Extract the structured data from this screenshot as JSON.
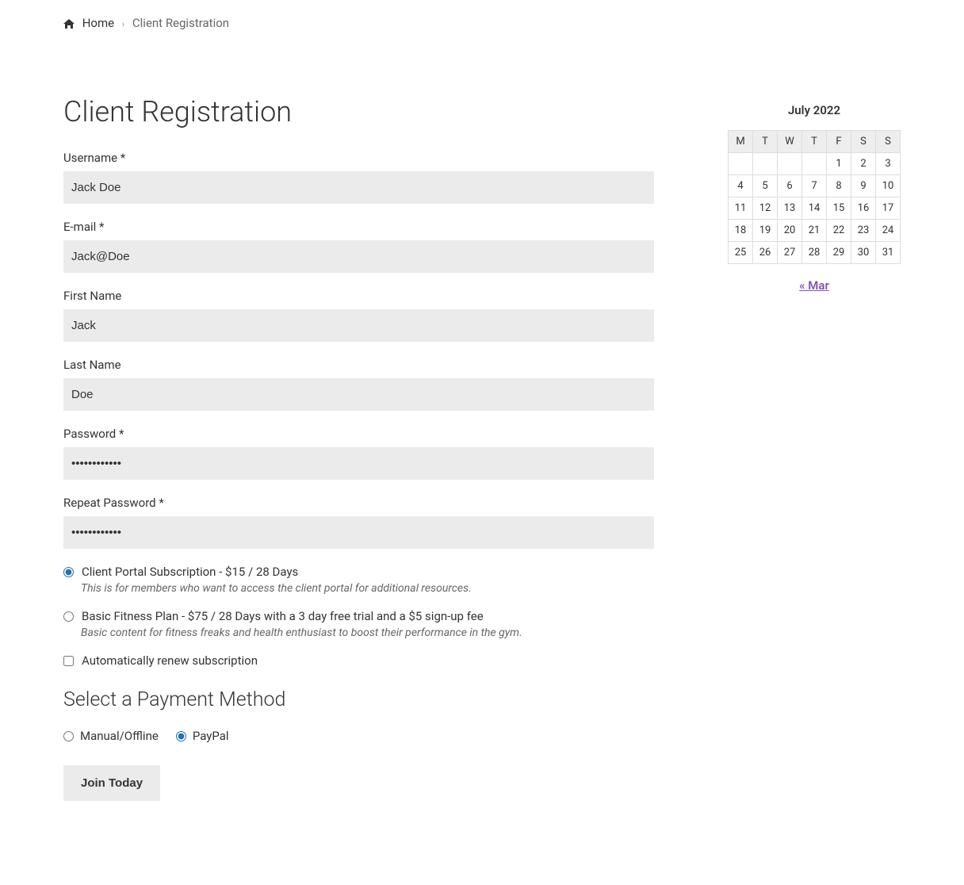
{
  "breadcrumb": {
    "home": "Home",
    "current": "Client Registration"
  },
  "page_title": "Client Registration",
  "form": {
    "username": {
      "label": "Username *",
      "value": "Jack Doe"
    },
    "email": {
      "label": "E-mail *",
      "value": "Jack@Doe"
    },
    "first_name": {
      "label": "First Name",
      "value": "Jack"
    },
    "last_name": {
      "label": "Last Name",
      "value": "Doe"
    },
    "password": {
      "label": "Password *",
      "value": "••••••••••••"
    },
    "repeat_password": {
      "label": "Repeat Password *",
      "value": "••••••••••••"
    }
  },
  "plans": [
    {
      "label": "Client Portal Subscription - $15 / 28 Days",
      "desc": "This is for members who want to access the client portal for additional resources.",
      "selected": true
    },
    {
      "label": "Basic Fitness Plan - $75 / 28 Days with a 3 day free trial and a $5 sign-up fee",
      "desc": "Basic content for fitness freaks and health enthusiast to boost their performance in the gym.",
      "selected": false
    }
  ],
  "auto_renew_label": "Automatically renew subscription",
  "payment_heading": "Select a Payment Method",
  "payment_methods": [
    {
      "label": "Manual/Offline",
      "selected": false
    },
    {
      "label": "PayPal",
      "selected": true
    }
  ],
  "submit_label": "Join Today",
  "calendar": {
    "caption": "July 2022",
    "dow": [
      "M",
      "T",
      "W",
      "T",
      "F",
      "S",
      "S"
    ],
    "weeks": [
      [
        "",
        "",
        "",
        "",
        "1",
        "2",
        "3"
      ],
      [
        "4",
        "5",
        "6",
        "7",
        "8",
        "9",
        "10"
      ],
      [
        "11",
        "12",
        "13",
        "14",
        "15",
        "16",
        "17"
      ],
      [
        "18",
        "19",
        "20",
        "21",
        "22",
        "23",
        "24"
      ],
      [
        "25",
        "26",
        "27",
        "28",
        "29",
        "30",
        "31"
      ]
    ],
    "prev_link": "« Mar"
  }
}
